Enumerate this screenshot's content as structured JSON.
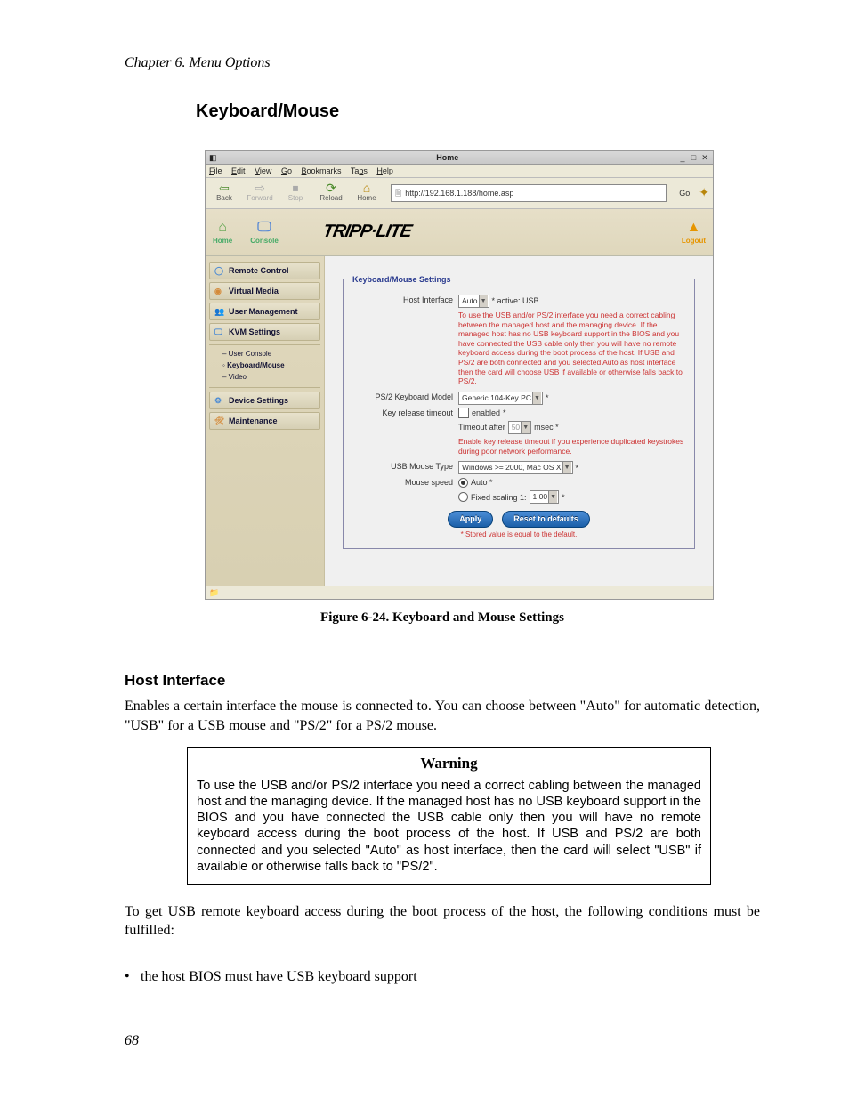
{
  "chapter": "Chapter 6. Menu Options",
  "section_title": "Keyboard/Mouse",
  "screenshot": {
    "window_title": "Home",
    "menubar": [
      "File",
      "Edit",
      "View",
      "Go",
      "Bookmarks",
      "Tabs",
      "Help"
    ],
    "toolbar": {
      "back": "Back",
      "forward": "Forward",
      "stop": "Stop",
      "reload": "Reload",
      "home": "Home",
      "url": "http://192.168.1.188/home.asp",
      "go": "Go"
    },
    "brand": {
      "home_label": "Home",
      "console_label": "Console",
      "logo_text": "TRIPP·LITE",
      "logout_label": "Logout"
    },
    "sidebar": {
      "items": [
        "Remote Control",
        "Virtual Media",
        "User Management",
        "KVM Settings",
        "Device Settings",
        "Maintenance"
      ],
      "subs": [
        "User Console",
        "Keyboard/Mouse",
        "Video"
      ]
    },
    "panel": {
      "legend": "Keyboard/Mouse Settings",
      "host_interface_label": "Host Interface",
      "host_interface_value": "Auto",
      "host_interface_suffix": "*  active: USB",
      "host_note": "To use the USB and/or PS/2 interface you need a correct cabling between the managed host and the managing device. If the managed host has no USB keyboard support in the BIOS and you have connected the USB cable only then you will have no remote keyboard access during the boot process of the host. If USB and PS/2 are both connected and you selected Auto as host interface then the card will choose USB if available or otherwise falls back to PS/2.",
      "ps2_model_label": "PS/2 Keyboard Model",
      "ps2_model_value": "Generic 104-Key PC",
      "key_release_label": "Key release timeout",
      "key_release_enabled": "enabled",
      "timeout_after_label": "Timeout after",
      "timeout_value": "50",
      "timeout_unit": "msec *",
      "key_release_note": "Enable key release timeout if you experience duplicated keystrokes during poor network performance.",
      "usb_mouse_label": "USB Mouse Type",
      "usb_mouse_value": "Windows >= 2000, Mac OS X",
      "mouse_speed_label": "Mouse speed",
      "mouse_speed_auto": "Auto *",
      "mouse_speed_fixed_label": "Fixed scaling 1:",
      "mouse_speed_fixed_value": "1.00",
      "apply": "Apply",
      "reset": "Reset to defaults",
      "stored_note": "* Stored value is equal to the default."
    }
  },
  "figure_caption": "Figure 6-24. Keyboard and Mouse Settings",
  "sub_heading": "Host Interface",
  "sub_text": "Enables a certain interface the mouse is connected to. You can choose between \"Auto\" for automatic detection, \"USB\" for a USB mouse and \"PS/2\" for a PS/2 mouse.",
  "warning": {
    "title": "Warning",
    "body": "To use the USB and/or PS/2 interface you need a correct cabling between the managed host and the managing device. If the managed host has no USB keyboard support in the BIOS and you have connected the USB cable only then you will have no remote keyboard access during the boot process of the host. If USB and PS/2 are both connected and you selected \"Auto\" as host interface, then the card will select \"USB\" if available or otherwise falls back to \"PS/2\"."
  },
  "after_warning": "To get USB remote keyboard access during the boot process of the host, the following conditions must be fulfilled:",
  "bullet1": "the host BIOS must have USB keyboard support",
  "page_num": "68"
}
